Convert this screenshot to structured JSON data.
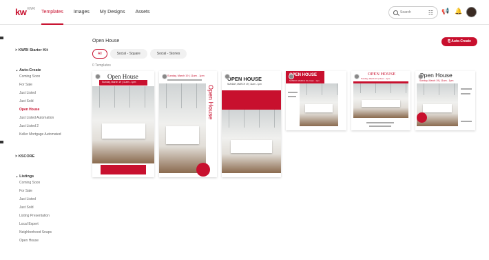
{
  "app": {
    "logo": "kw",
    "logo_sub": "KWRI"
  },
  "nav": [
    "Templates",
    "Images",
    "My Designs",
    "Assets"
  ],
  "search": {
    "placeholder": "Search"
  },
  "sidebar": {
    "groups": [
      {
        "label": "KWRI Starter Kit",
        "items": []
      },
      {
        "label": "Auto-Create",
        "items": [
          "Coming Soon",
          "For Sale",
          "Just Listed",
          "Just Sold",
          "Open House",
          "Just Listed Automation",
          "Just Listed 2",
          "Keller Mortgage Automated"
        ]
      },
      {
        "label": "KSCORE",
        "items": []
      },
      {
        "label": "Listings",
        "items": [
          "Coming Soon",
          "For Sale",
          "Just Listed",
          "Just Sold",
          "Listing Presentation",
          "Local Expert",
          "Neighborhood Snaps",
          "Open House"
        ]
      }
    ],
    "active_item": "Open House"
  },
  "main": {
    "title": "Open House",
    "auto_create_label": "Auto-Create",
    "filters": [
      "All",
      "Social - Square",
      "Social - Stories"
    ],
    "active_filter": "All",
    "count_label": "0 Templates"
  },
  "templates": [
    {
      "headline": "Open House",
      "subline": "Sunday, March 19 | 11am - 1pm"
    },
    {
      "headline": "Open House",
      "subline": "Sunday, March 19 | 11am - 1pm"
    },
    {
      "headline": "OPEN HOUSE",
      "subline": "SUNDAY, MARCH 19 | 11am - 1pm"
    },
    {
      "headline": "OPEN HOUSE",
      "subline": "SUNDAY, MARCH 19 | 11am - 1pm"
    },
    {
      "headline": "OPEN HOUSE",
      "subline": "Sunday, March 19 | 11am - 1pm"
    },
    {
      "headline": "Open House",
      "subline": "Sunday, March 19 | 11am - 1pm"
    }
  ],
  "colors": {
    "brand": "#c8102e"
  },
  "icons": [
    "search-icon",
    "filter-icon",
    "megaphone-icon",
    "bell-icon",
    "avatar"
  ]
}
